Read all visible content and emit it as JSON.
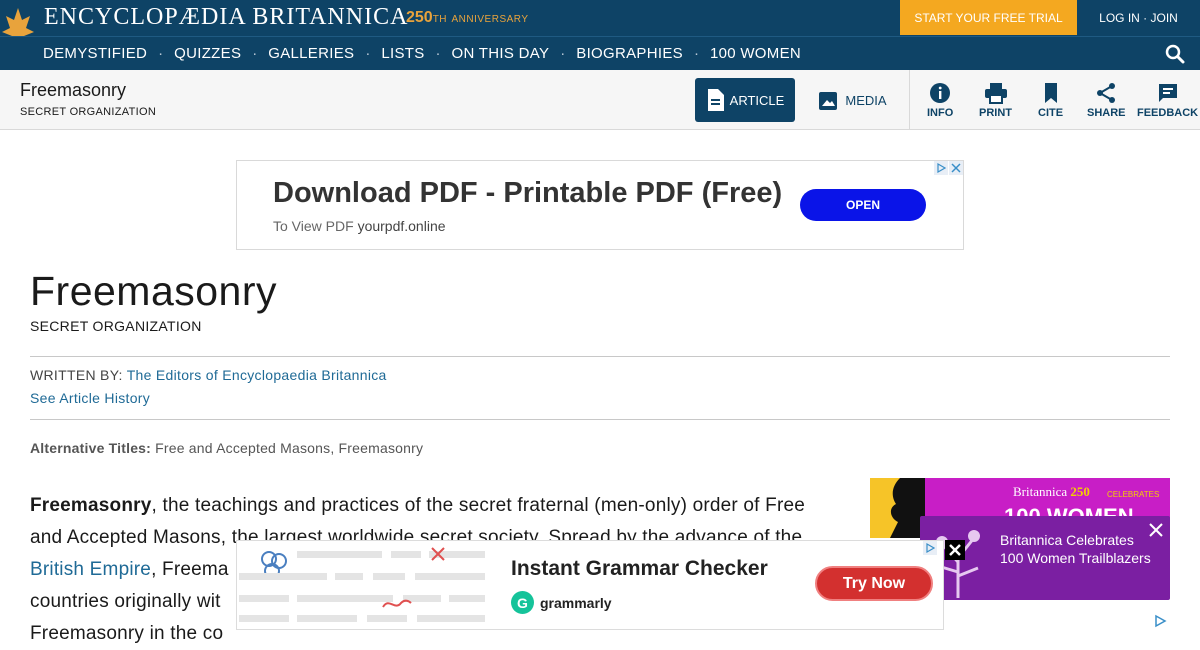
{
  "header": {
    "brand": "ENCYCLOPÆDIA BRITANNICA",
    "anniversary_number": "250",
    "anniversary_tm": "TH",
    "anniversary_word": "ANNIVERSARY",
    "trial_button": "START YOUR FREE TRIAL",
    "login_join": "LOG IN · JOIN"
  },
  "nav": {
    "items": [
      "DEMYSTIFIED",
      "QUIZZES",
      "GALLERIES",
      "LISTS",
      "ON THIS DAY",
      "BIOGRAPHIES",
      "100 WOMEN"
    ],
    "separator": "·"
  },
  "toolbar": {
    "title": "Freemasonry",
    "subtitle": "SECRET ORGANIZATION",
    "article_tab": "ARTICLE",
    "media_tab": "MEDIA",
    "tools": [
      "INFO",
      "PRINT",
      "CITE",
      "SHARE",
      "FEEDBACK"
    ]
  },
  "ad_top": {
    "headline": "Download PDF - Printable PDF (Free)",
    "sub_prefix": "To View PDF",
    "sub_domain": "yourpdf.online",
    "button": "OPEN"
  },
  "article": {
    "title": "Freemasonry",
    "subtitle": "SECRET ORGANIZATION",
    "written_by_label": "WRITTEN BY:",
    "author": "The Editors of Encyclopaedia Britannica",
    "history_link": "See Article History",
    "alt_titles_label": "Alternative Titles:",
    "alt_titles": "Free and Accepted Masons, Freemasonry",
    "para_bold": "Freemasonry",
    "para_line1": ", the teachings and practices of the secret fraternal (men-only) order of Free",
    "para_line2": "and Accepted Masons, the largest worldwide secret society. Spread by the advance of the",
    "para_link": "British Empire",
    "para_line3": ", Freema",
    "para_line4": "countries originally wit",
    "para_line5": "Freemasonry in the co"
  },
  "promo": {
    "britannica": "Britannica",
    "number": "250",
    "celebrates": "CELEBRATES",
    "big": "100 WOMEN"
  },
  "toast": {
    "text": "Britannica Celebrates 100 Women Trailblazers"
  },
  "ad_bottom": {
    "headline": "Instant Grammar Checker",
    "brand_letter": "G",
    "brand": "grammarly",
    "button": "Try Now"
  },
  "colors": {
    "header_bg": "#0e4366",
    "trial_bg": "#f4a820",
    "link": "#1f6a96",
    "promo_bg": "#c81ec6",
    "toast_bg": "#7b1fa2",
    "ad_open_bg": "#0a14e8",
    "ad_try_bg": "#d3302f"
  }
}
